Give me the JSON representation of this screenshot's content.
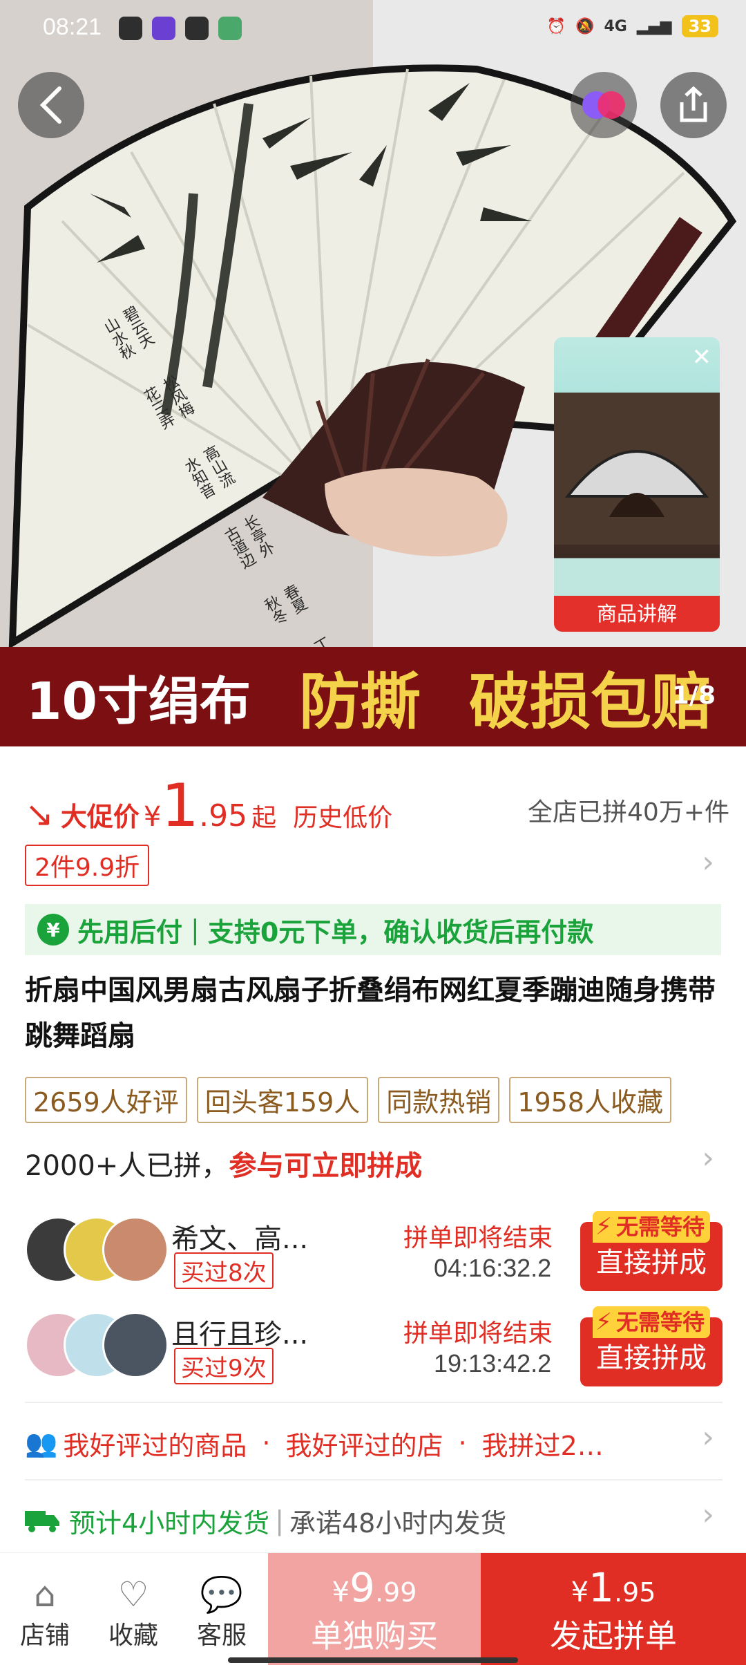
{
  "status_bar": {
    "time": "08:21",
    "network": "4G",
    "battery": "33"
  },
  "hero": {
    "calligraphy": [
      "碧云天山水秋",
      "松风梅花三弄",
      "高山流水知音",
      "长亭外古道边",
      "春夏秋冬",
      "丁酉年秋"
    ],
    "video_caption": "商品讲解",
    "banner": [
      "10寸绢布",
      "防撕",
      "破损包赔"
    ],
    "pager": "1/8"
  },
  "price": {
    "promo_label": "大促价",
    "currency": "¥",
    "integer": "1",
    "decimal": ".95",
    "suffix": "起",
    "low_tag": "历史低价",
    "sold": "全店已拼40万+件"
  },
  "coupon": "2件9.9折",
  "pay_later": {
    "title": "先用后付",
    "desc": "支持0元下单，确认收货后再付款"
  },
  "title": "折扇中国风男扇古风扇子折叠绢布网红夏季蹦迪随身携带跳舞蹈扇",
  "tags": [
    "2659人好评",
    "回头客159人",
    "同款热销",
    "1958人收藏"
  ],
  "group": {
    "count_text": "2000+人已拼，",
    "highlight": "参与可立即拼成",
    "rows": [
      {
        "name": "希文、高...",
        "bought": "买过8次",
        "ending": "拼单即将结束",
        "countdown": "04:16:32.2",
        "badge": "无需等待",
        "button": "直接拼成"
      },
      {
        "name": "且行且珍...",
        "bought": "买过9次",
        "ending": "拼单即将结束",
        "countdown": "19:13:42.2",
        "badge": "无需等待",
        "button": "直接拼成"
      }
    ]
  },
  "reviewed": [
    "我好评过的商品",
    "我好评过的店",
    "我拼过2…"
  ],
  "reviewed_sep": "·",
  "shipping": {
    "estimate": "预计4小时内发货",
    "promise": "承诺48小时内发货"
  },
  "bottom_bar": {
    "store": "店铺",
    "favorite": "收藏",
    "service": "客服",
    "solo": {
      "currency": "¥",
      "integer": "9",
      "decimal": ".99",
      "label": "单独购买"
    },
    "group": {
      "currency": "¥",
      "integer": "1",
      "decimal": ".95",
      "label": "发起拼单"
    }
  },
  "colors": {
    "brand_red": "#e02e24",
    "green": "#1aa33a",
    "banner_bg": "#7b0f12",
    "banner_text": "#f4d34b"
  }
}
